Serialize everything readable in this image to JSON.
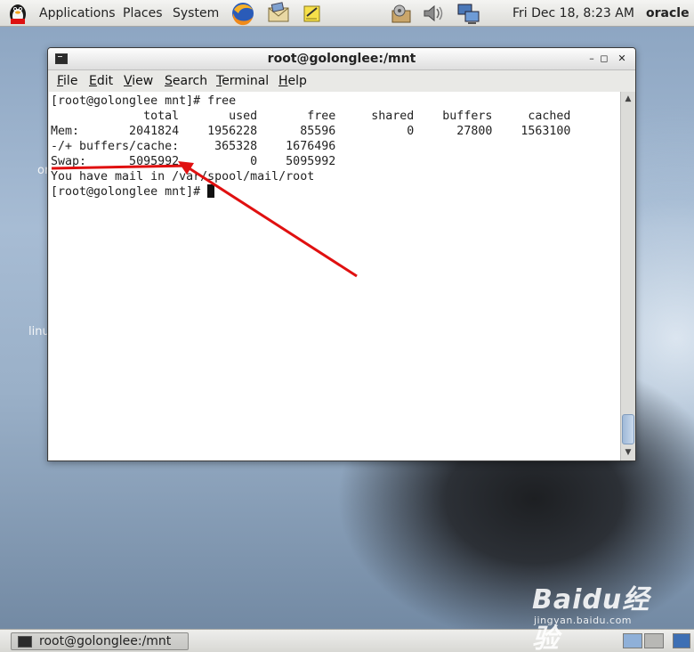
{
  "top_panel": {
    "menus": [
      "Applications",
      "Places",
      "System"
    ],
    "launchers": [
      "firefox-icon",
      "mail-icon",
      "notes-icon"
    ],
    "tray": [
      "update-icon",
      "volume-icon",
      "network-icon"
    ],
    "clock": "Fri Dec 18,  8:23 AM",
    "user": "oracle"
  },
  "desktop": {
    "labels": [
      "or",
      "linu"
    ]
  },
  "window": {
    "title": "root@golonglee:/mnt",
    "menu": [
      "File",
      "Edit",
      "View",
      "Search",
      "Terminal",
      "Help"
    ],
    "buttons": [
      "–",
      "◻",
      "✕"
    ]
  },
  "terminal": {
    "prompt": "[root@golonglee mnt]# ",
    "command": "free",
    "header": "             total       used       free     shared    buffers     cached",
    "mem": "Mem:       2041824    1956228      85596          0      27800    1563100",
    "buffers_cache": "-/+ buffers/cache:     365328    1676496",
    "swap": "Swap:      5095992          0    5095992",
    "mail": "You have mail in /var/spool/mail/root",
    "free_table": {
      "columns": [
        "total",
        "used",
        "free",
        "shared",
        "buffers",
        "cached"
      ],
      "rows": [
        {
          "label": "Mem:",
          "values": [
            2041824,
            1956228,
            85596,
            0,
            27800,
            1563100
          ]
        },
        {
          "label": "-/+ buffers/cache:",
          "values": [
            null,
            365328,
            1676496
          ]
        },
        {
          "label": "Swap:",
          "values": [
            5095992,
            0,
            5095992
          ]
        }
      ]
    }
  },
  "annotation": {
    "color": "#e01010"
  },
  "bottom_panel": {
    "task_label": "root@golonglee:/mnt"
  },
  "watermark": {
    "brand": "Baidu经验",
    "sub": "jingyan.baidu.com"
  }
}
